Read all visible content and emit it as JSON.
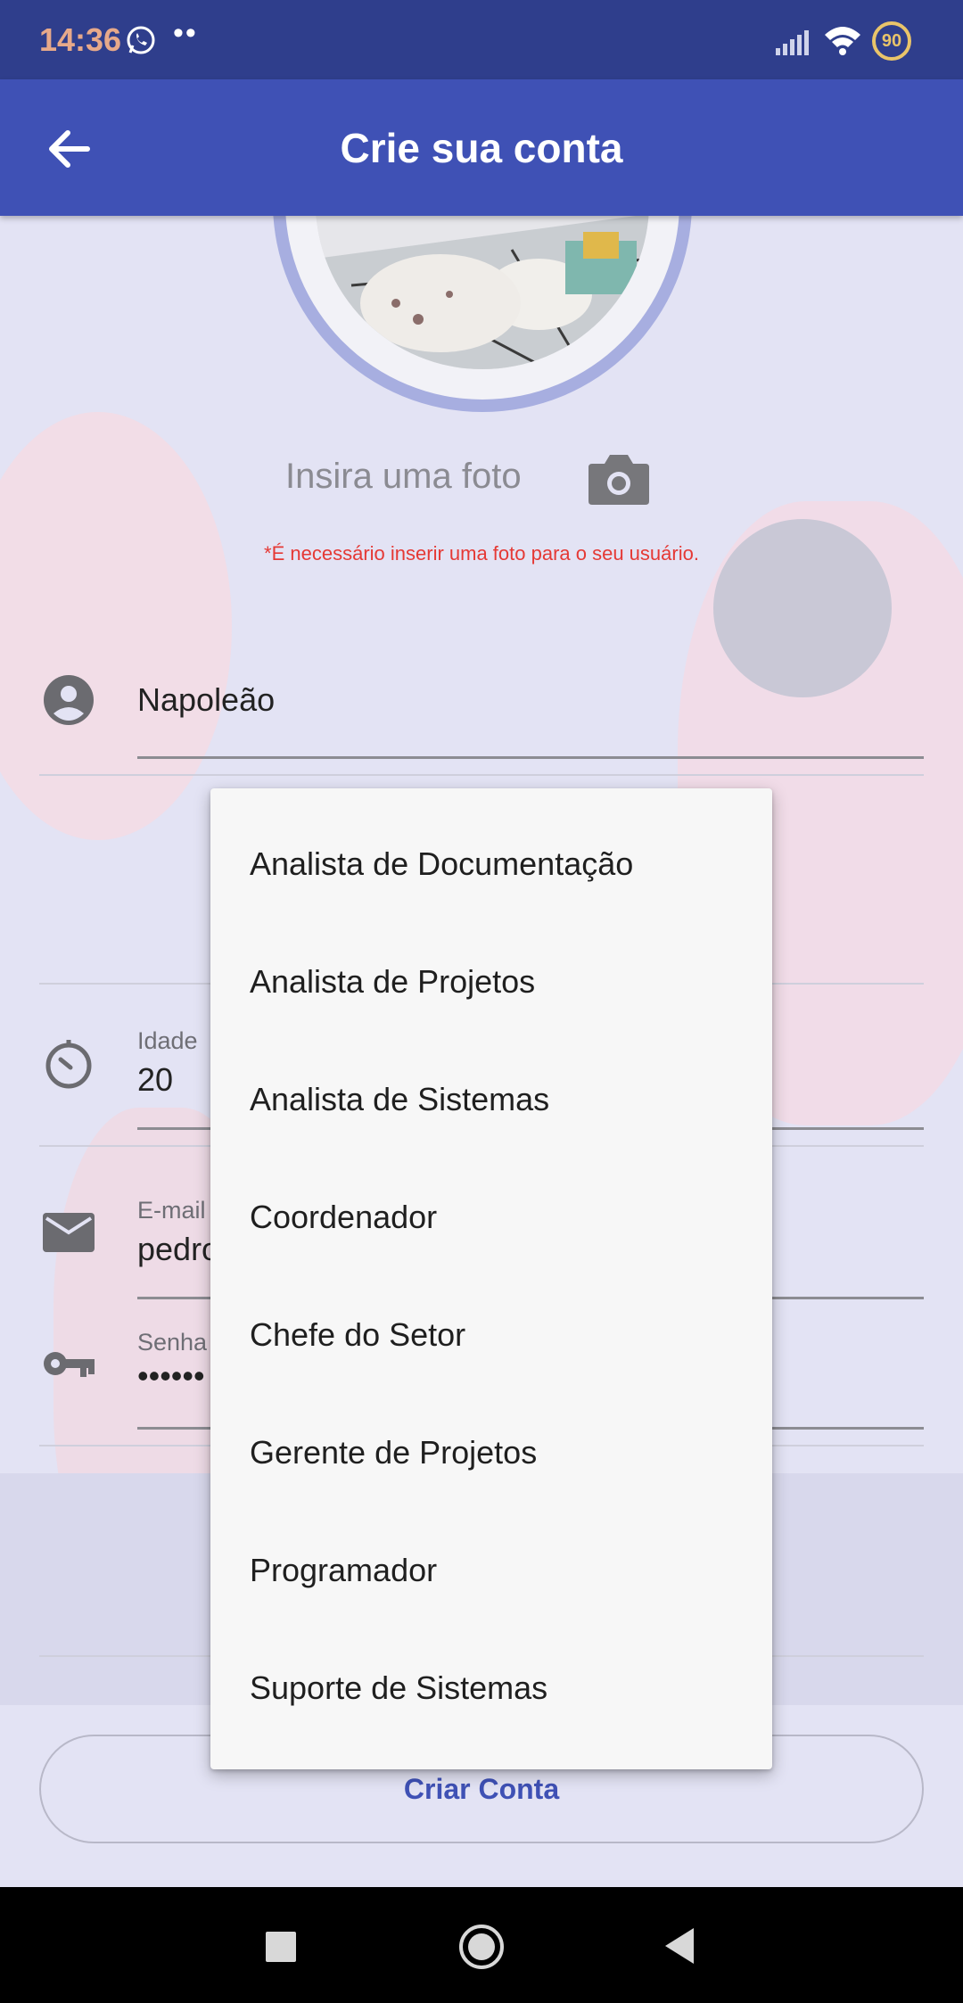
{
  "status_bar": {
    "time": "14:36",
    "dots": "••",
    "battery": "90"
  },
  "app_bar": {
    "title": "Crie sua conta"
  },
  "photo": {
    "label": "Insira uma foto",
    "warning": "*É necessário inserir uma foto para o seu usuário."
  },
  "form": {
    "name": {
      "value": "Napoleão"
    },
    "age": {
      "label": "Idade",
      "value": "20"
    },
    "email": {
      "label": "E-mail",
      "value": "pedro"
    },
    "password": {
      "label": "Senha",
      "value": "••••••"
    }
  },
  "dropdown": {
    "items": [
      "Analista de Documentação",
      "Analista de Projetos",
      "Analista de Sistemas",
      "Coordenador",
      "Chefe do Setor",
      "Gerente de Projetos",
      "Programador",
      "Suporte de Sistemas"
    ]
  },
  "buttons": {
    "create": "Criar Conta"
  },
  "colors": {
    "primary": "#3f51b5",
    "status_bar": "#2f3e8c",
    "warning": "#e53935"
  }
}
